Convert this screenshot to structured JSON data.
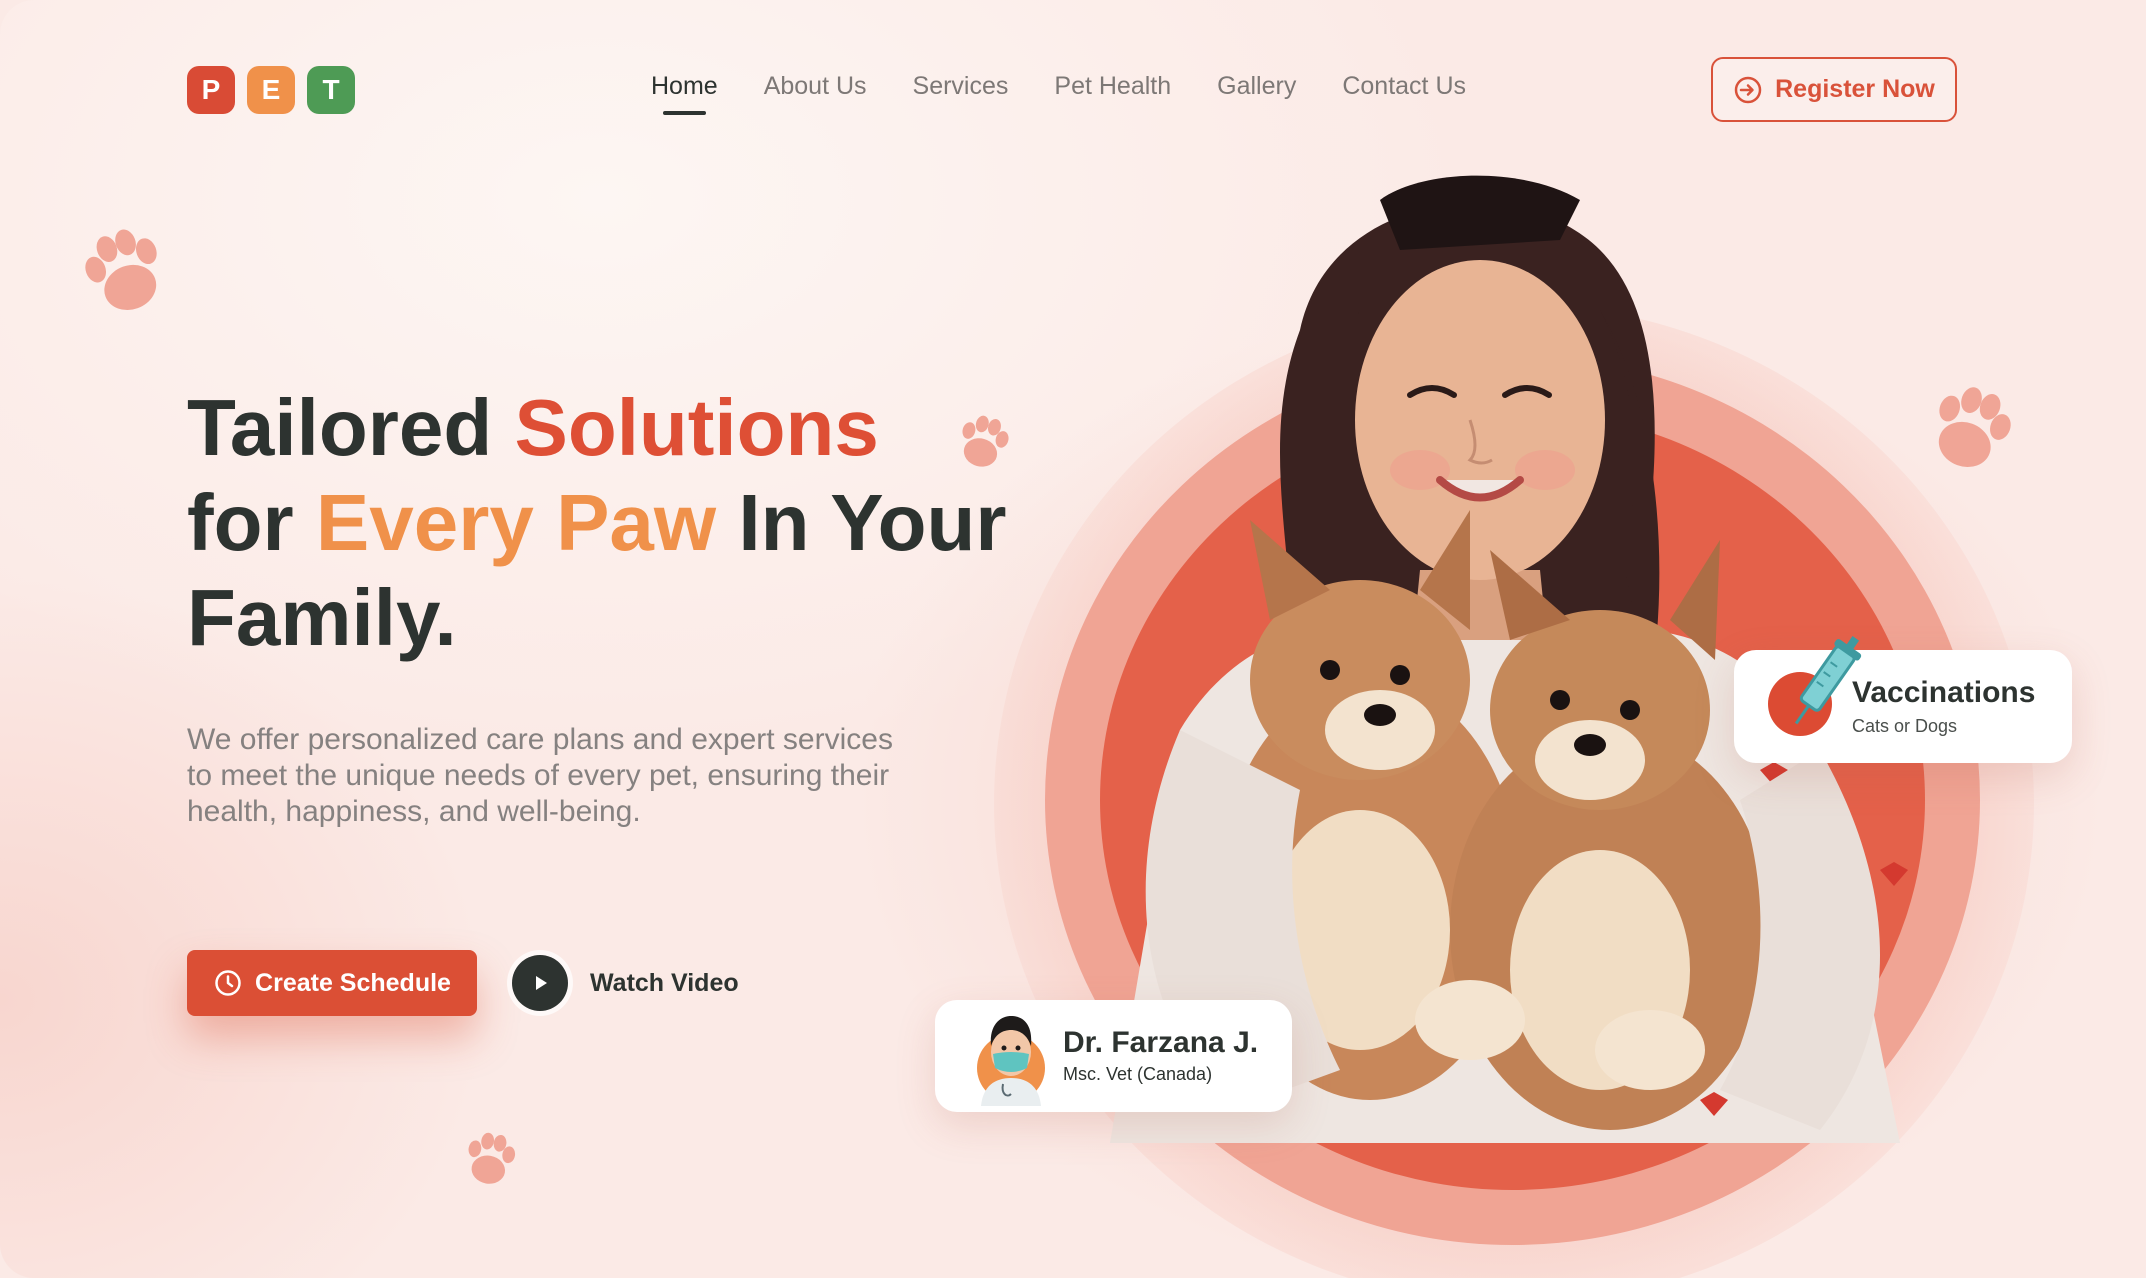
{
  "logo": {
    "letters": [
      "P",
      "E",
      "T"
    ],
    "colors": [
      "#d94b35",
      "#f0914a",
      "#4e9b55"
    ]
  },
  "nav": {
    "items": [
      "Home",
      "About Us",
      "Services",
      "Pet Health",
      "Gallery",
      "Contact Us"
    ],
    "active": "Home"
  },
  "header": {
    "register_label": "Register Now",
    "register_icon": "login-arrow-icon"
  },
  "hero": {
    "title": {
      "part1": "Tailored ",
      "part2": "Solutions",
      "part3": "for ",
      "part4": "Every Paw",
      "part5": " In Your",
      "part6": "Family."
    },
    "description": "We offer personalized care plans and expert services to meet the unique needs of every pet, ensuring their health, happiness, and well-being.",
    "schedule_label": "Create Schedule",
    "schedule_icon": "clock-icon",
    "watch_label": "Watch Video",
    "watch_icon": "play-icon"
  },
  "cards": {
    "vaccination": {
      "title": "Vaccinations",
      "subtitle": "Cats or Dogs",
      "icon": "syringe-icon"
    },
    "doctor": {
      "name": "Dr. Farzana J.",
      "title": "Msc. Vet (Canada)",
      "icon": "doctor-avatar"
    }
  },
  "colors": {
    "accent_red": "#db4f35",
    "accent_orange": "#f0914a",
    "text_dark": "#2d3330",
    "paw_pink": "#f0a596"
  }
}
